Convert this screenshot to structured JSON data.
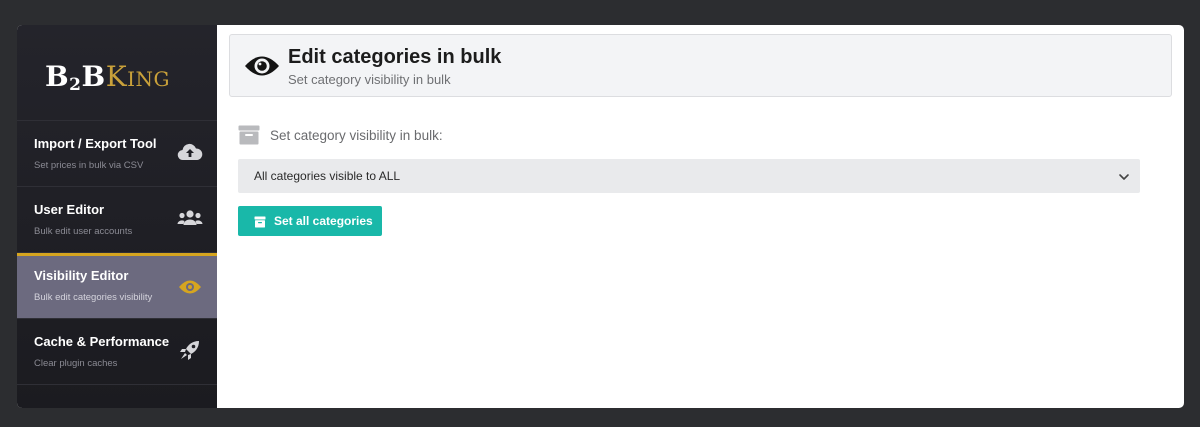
{
  "brand": {
    "part1": "B",
    "part2": "2",
    "part3": "B",
    "part4": "King"
  },
  "sidebar": {
    "items": [
      {
        "title": "Import / Export Tool",
        "subtitle": "Set prices in bulk via CSV",
        "icon": "cloud-upload-icon",
        "active": false
      },
      {
        "title": "User Editor",
        "subtitle": "Bulk edit user accounts",
        "icon": "users-icon",
        "active": false
      },
      {
        "title": "Visibility Editor",
        "subtitle": "Bulk edit categories visibility",
        "icon": "eye-icon",
        "active": true
      },
      {
        "title": "Cache & Performance",
        "subtitle": "Clear plugin caches",
        "icon": "rocket-icon",
        "active": false
      }
    ]
  },
  "header": {
    "title": "Edit categories in bulk",
    "subtitle": "Set category visibility in bulk",
    "icon": "eye-icon"
  },
  "form": {
    "label": "Set category visibility in bulk:",
    "select_value": "All categories visible to ALL",
    "button_label": "Set all categories"
  },
  "colors": {
    "accent": "#19b8a9",
    "active_border": "#d6a51f",
    "active_bg": "#6c6a7f",
    "sidebar_bg": "#1f1f25",
    "gold": "#c9a13a"
  }
}
